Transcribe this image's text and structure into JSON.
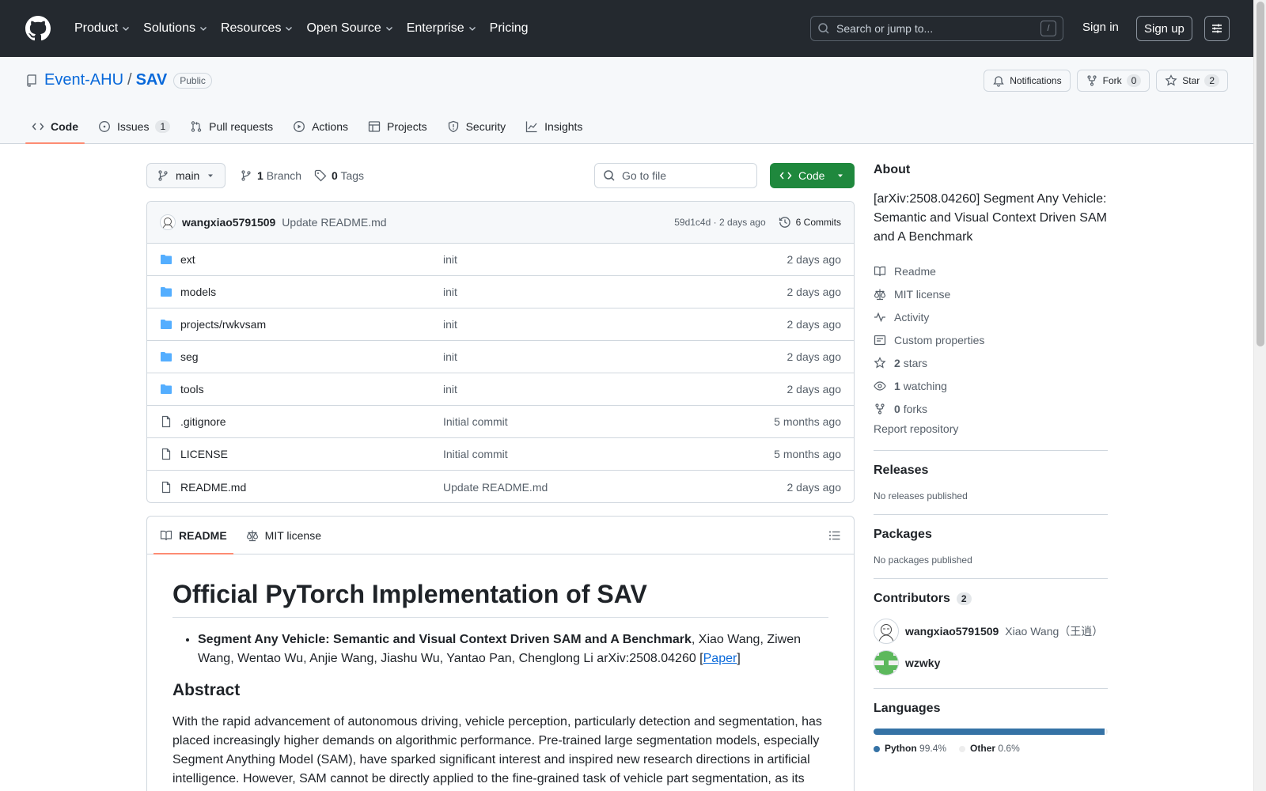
{
  "header": {
    "nav": [
      {
        "label": "Product",
        "dropdown": true
      },
      {
        "label": "Solutions",
        "dropdown": true
      },
      {
        "label": "Resources",
        "dropdown": true
      },
      {
        "label": "Open Source",
        "dropdown": true
      },
      {
        "label": "Enterprise",
        "dropdown": true
      },
      {
        "label": "Pricing",
        "dropdown": false
      }
    ],
    "search_placeholder": "Search or jump to...",
    "search_shortcut": "/",
    "sign_in": "Sign in",
    "sign_up": "Sign up"
  },
  "repo": {
    "owner": "Event-AHU",
    "separator": "/",
    "name": "SAV",
    "visibility": "Public",
    "notifications_label": "Notifications",
    "fork_label": "Fork",
    "fork_count": "0",
    "star_label": "Star",
    "star_count": "2",
    "tabs": [
      {
        "label": "Code",
        "icon": "code-icon",
        "active": true,
        "count": null
      },
      {
        "label": "Issues",
        "icon": "issue-icon",
        "active": false,
        "count": "1"
      },
      {
        "label": "Pull requests",
        "icon": "pull-request-icon",
        "active": false,
        "count": null
      },
      {
        "label": "Actions",
        "icon": "play-icon",
        "active": false,
        "count": null
      },
      {
        "label": "Projects",
        "icon": "table-icon",
        "active": false,
        "count": null
      },
      {
        "label": "Security",
        "icon": "shield-icon",
        "active": false,
        "count": null
      },
      {
        "label": "Insights",
        "icon": "graph-icon",
        "active": false,
        "count": null
      }
    ]
  },
  "file_nav": {
    "branch": "main",
    "branch_count": "1",
    "branch_label": "Branch",
    "tag_count": "0",
    "tag_label": "Tags",
    "goto_placeholder": "Go to file",
    "code_button": "Code"
  },
  "commit": {
    "author": "wangxiao5791509",
    "message": "Update README.md",
    "hash_time": "59d1c4d · 2 days ago",
    "commits_label": "6 Commits"
  },
  "files": [
    {
      "name": "ext",
      "type": "dir",
      "message": "init",
      "date": "2 days ago"
    },
    {
      "name": "models",
      "type": "dir",
      "message": "init",
      "date": "2 days ago"
    },
    {
      "name": "projects/rwkvsam",
      "type": "dir",
      "message": "init",
      "date": "2 days ago"
    },
    {
      "name": "seg",
      "type": "dir",
      "message": "init",
      "date": "2 days ago"
    },
    {
      "name": "tools",
      "type": "dir",
      "message": "init",
      "date": "2 days ago"
    },
    {
      "name": ".gitignore",
      "type": "file",
      "message": "Initial commit",
      "date": "5 months ago"
    },
    {
      "name": "LICENSE",
      "type": "file",
      "message": "Initial commit",
      "date": "5 months ago"
    },
    {
      "name": "README.md",
      "type": "file",
      "message": "Update README.md",
      "date": "2 days ago"
    }
  ],
  "readme": {
    "tab_readme": "README",
    "tab_license": "MIT license",
    "title": "Official PyTorch Implementation of SAV",
    "bullet_bold": "Segment Any Vehicle: Semantic and Visual Context Driven SAM and A Benchmark",
    "bullet_rest": ", Xiao Wang, Ziwen Wang, Wentao Wu, Anjie Wang, Jiashu Wu, Yantao Pan, Chenglong Li arXiv:2508.04260 [",
    "bullet_link": "Paper",
    "bullet_end": "]",
    "abstract_heading": "Abstract",
    "abstract_text": "With the rapid advancement of autonomous driving, vehicle perception, particularly detection and segmentation, has placed increasingly higher demands on algorithmic performance. Pre-trained large segmentation models, especially Segment Anything Model (SAM), have sparked significant interest and inspired new research directions in artificial intelligence. However, SAM cannot be directly applied to the fine-grained task of vehicle part segmentation, as its"
  },
  "sidebar": {
    "about_heading": "About",
    "description": "[arXiv:2508.04260] Segment Any Vehicle: Semantic and Visual Context Driven SAM and A Benchmark",
    "readme": "Readme",
    "license": "MIT license",
    "activity": "Activity",
    "custom_properties": "Custom properties",
    "stars_count": "2",
    "stars_label": "stars",
    "watching_count": "1",
    "watching_label": "watching",
    "forks_count": "0",
    "forks_label": "forks",
    "report": "Report repository",
    "releases_heading": "Releases",
    "releases_empty": "No releases published",
    "packages_heading": "Packages",
    "packages_empty": "No packages published",
    "contributors_heading": "Contributors",
    "contributors_count": "2",
    "contributors": [
      {
        "login": "wangxiao5791509",
        "name": "Xiao Wang（王逍）"
      },
      {
        "login": "wzwky",
        "name": ""
      }
    ],
    "languages_heading": "Languages",
    "languages": [
      {
        "name": "Python",
        "percent": "99.4%",
        "fraction": 0.994,
        "color": "#3572A5"
      },
      {
        "name": "Other",
        "percent": "0.6%",
        "fraction": 0.006,
        "color": "#ededed"
      }
    ]
  }
}
